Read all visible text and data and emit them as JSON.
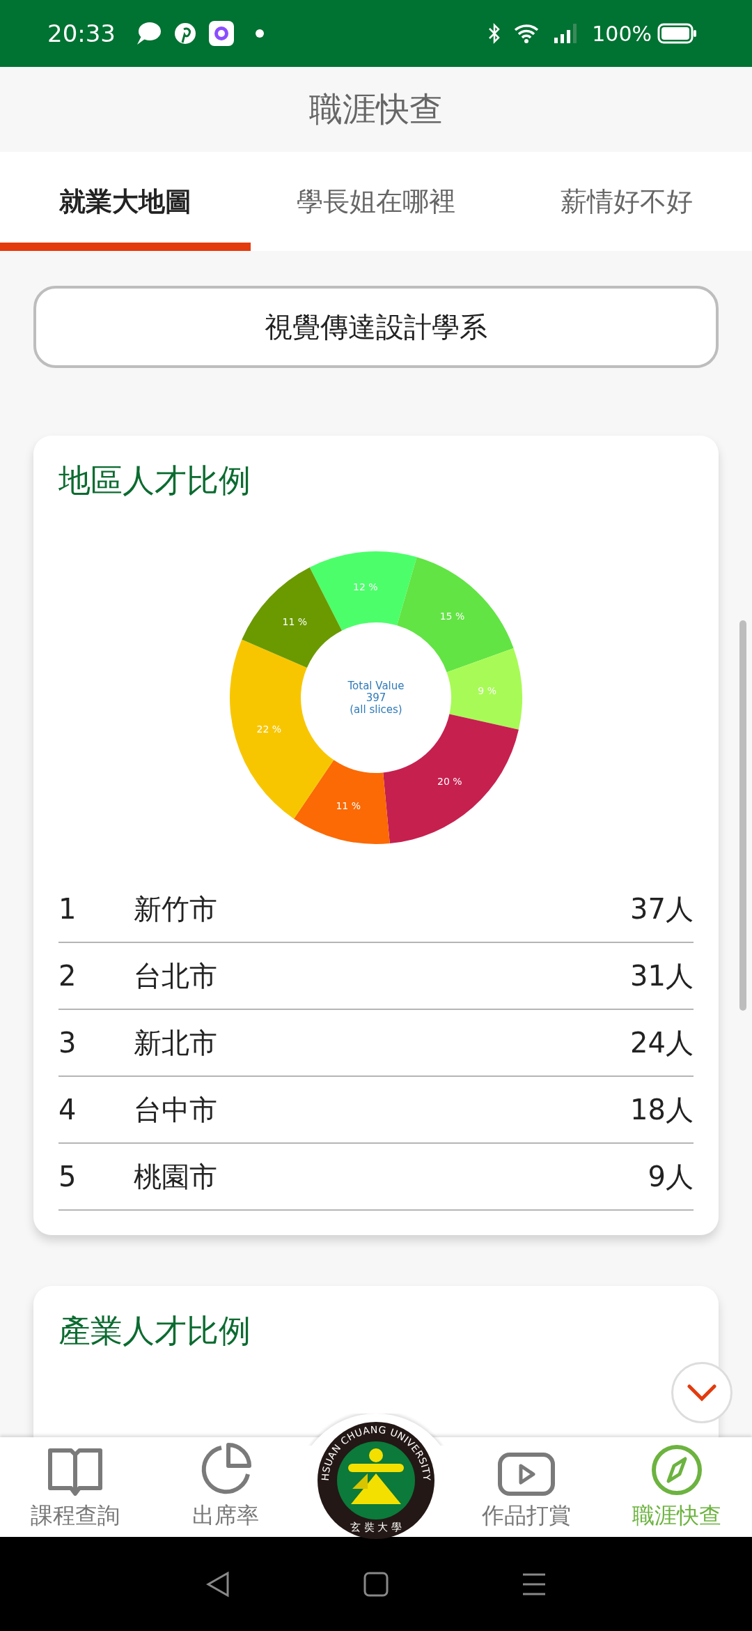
{
  "status_bar": {
    "time": "20:33",
    "battery": "100%"
  },
  "app_bar": {
    "title": "職涯快查"
  },
  "tabs": [
    {
      "label": "就業大地圖",
      "selected": true
    },
    {
      "label": "學長姐在哪裡",
      "selected": false
    },
    {
      "label": "薪情好不好",
      "selected": false
    }
  ],
  "department_button": {
    "label": "視覺傳達設計學系"
  },
  "region_card": {
    "title": "地區人才比例",
    "chart_data": {
      "type": "donut",
      "values": [
        12,
        15,
        9,
        20,
        11,
        22,
        11
      ],
      "colors": [
        "#4cff6a",
        "#62e444",
        "#a8fb56",
        "#c6204f",
        "#fb6a04",
        "#f8c600",
        "#6a9a00"
      ],
      "value_labels": [
        "12 %",
        "15 %",
        "9 %",
        "20 %",
        "11 %",
        "22 %",
        "11 %"
      ],
      "annotations": [
        "Total Value",
        "397",
        "(all slices)"
      ]
    },
    "rows": [
      {
        "rank": "1",
        "name": "新竹市",
        "count": "37人"
      },
      {
        "rank": "2",
        "name": "台北市",
        "count": "31人"
      },
      {
        "rank": "3",
        "name": "新北市",
        "count": "24人"
      },
      {
        "rank": "4",
        "name": "台中市",
        "count": "18人"
      },
      {
        "rank": "5",
        "name": "桃園市",
        "count": "9人"
      }
    ]
  },
  "industry_card": {
    "title": "產業人才比例"
  },
  "bottom_nav": [
    {
      "kind": "book",
      "label": "課程查詢",
      "selected": false
    },
    {
      "kind": "pie",
      "label": "出席率",
      "selected": false
    },
    {
      "kind": "logo",
      "ring_text": "HSUAN CHUANG UNIVERSITY",
      "bottom_text": "玄 奘 大 學"
    },
    {
      "kind": "video",
      "label": "作品打賞",
      "selected": false
    },
    {
      "kind": "compass",
      "label": "職涯快查",
      "selected": true
    }
  ]
}
